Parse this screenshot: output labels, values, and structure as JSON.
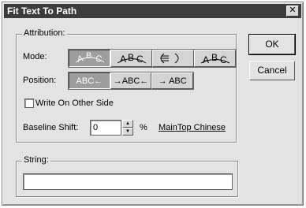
{
  "window": {
    "title": "Fit Text To Path",
    "close_glyph": "✕"
  },
  "attribution": {
    "group_label": "Attribution:",
    "mode_label": "Mode:",
    "modes": [
      {
        "icon": "text-on-path-rotate-icon",
        "pressed": true
      },
      {
        "icon": "text-on-path-vertical-skew-icon",
        "pressed": false
      },
      {
        "icon": "text-on-path-horizontal-skew-icon",
        "pressed": false
      },
      {
        "icon": "text-on-path-upright-icon",
        "pressed": false
      }
    ],
    "position_label": "Position:",
    "positions": [
      {
        "text": "ABC←",
        "pressed": true
      },
      {
        "text": "→ABC←",
        "pressed": false
      },
      {
        "text": "→ ABC",
        "pressed": false
      }
    ],
    "write_other_side_label": "Write On Other Side",
    "write_other_side_checked": false,
    "baseline_shift_label": "Baseline Shift:",
    "baseline_shift_value": "0",
    "baseline_shift_unit": "%",
    "font_name": "MainTop Chinese"
  },
  "string": {
    "group_label": "String:",
    "value": ""
  },
  "buttons": {
    "ok": "OK",
    "cancel": "Cancel"
  }
}
